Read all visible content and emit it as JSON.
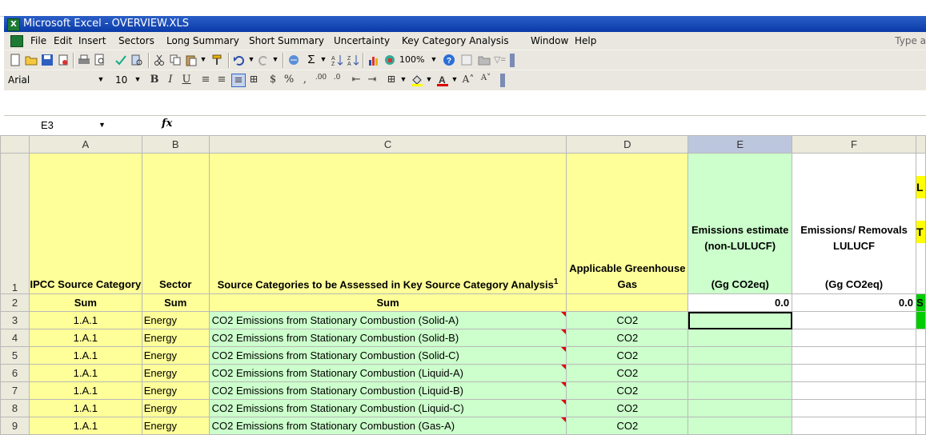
{
  "window": {
    "title": "Microsoft Excel - OVERVIEW.XLS"
  },
  "menu": {
    "items": [
      "File",
      "Edit",
      "Insert",
      "Sectors",
      "Long Summary",
      "Short Summary",
      "Uncertainty",
      "Key Category Analysis",
      "Window",
      "Help"
    ],
    "type_help": "Type a"
  },
  "toolbar": {
    "zoom": "100%"
  },
  "format_toolbar": {
    "font": "Arial",
    "size": "10"
  },
  "formula_bar": {
    "name_box": "E3",
    "fx": "fx",
    "formula": ""
  },
  "columns": [
    "A",
    "B",
    "C",
    "D",
    "E",
    "F"
  ],
  "header_row": {
    "row_num": "1",
    "a": "IPCC Source Category",
    "b": "Sector",
    "c": "Source Categories to be Assessed in Key Source Category Analysis",
    "c_sup": "1",
    "d": "Applicable Greenhouse Gas",
    "e_line1": "Emissions estimate (non-LULUCF)",
    "e_line2": "(Gg CO2eq)",
    "f_line1": "Emissions/ Removals LULUCF",
    "f_line2": "(Gg CO2eq)",
    "g_partial_top": "L",
    "g_partial_bottom": "T"
  },
  "sum_row": {
    "row_num": "2",
    "a": "Sum",
    "b": "Sum",
    "c": "Sum",
    "e": "0.0",
    "f": "0.0",
    "g_partial": "S"
  },
  "rows": [
    {
      "row_num": "3",
      "a": "1.A.1",
      "b": "Energy",
      "c": "CO2 Emissions from Stationary Combustion (Solid-A)",
      "d": "CO2"
    },
    {
      "row_num": "4",
      "a": "1.A.1",
      "b": "Energy",
      "c": "CO2 Emissions from Stationary Combustion (Solid-B)",
      "d": "CO2"
    },
    {
      "row_num": "5",
      "a": "1.A.1",
      "b": "Energy",
      "c": "CO2 Emissions from Stationary Combustion (Solid-C)",
      "d": "CO2"
    },
    {
      "row_num": "6",
      "a": "1.A.1",
      "b": "Energy",
      "c": "CO2 Emissions from Stationary Combustion (Liquid-A)",
      "d": "CO2"
    },
    {
      "row_num": "7",
      "a": "1.A.1",
      "b": "Energy",
      "c": "CO2 Emissions from Stationary Combustion (Liquid-B)",
      "d": "CO2"
    },
    {
      "row_num": "8",
      "a": "1.A.1",
      "b": "Energy",
      "c": "CO2 Emissions from Stationary Combustion (Liquid-C)",
      "d": "CO2"
    },
    {
      "row_num": "9",
      "a": "1.A.1",
      "b": "Energy",
      "c": "CO2 Emissions from Stationary Combustion (Gas-A)",
      "d": "CO2"
    }
  ],
  "colors": {
    "title_bar": "#0a3aa8",
    "header_fill": "#ffff99",
    "data_fill": "#ccffcc",
    "accent_green": "#00cc00",
    "comment_marker": "#e00000"
  }
}
